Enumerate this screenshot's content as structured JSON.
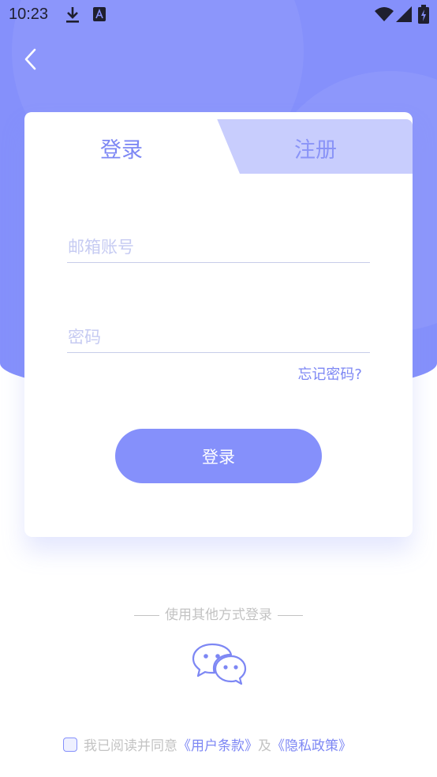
{
  "status_bar": {
    "time": "10:23"
  },
  "tabs": {
    "login_label": "登录",
    "register_label": "注册"
  },
  "form": {
    "email_placeholder": "邮箱账号",
    "email_value": "",
    "password_placeholder": "密码",
    "password_value": "",
    "forgot_label": "忘记密码?",
    "submit_label": "登录"
  },
  "alt_login": {
    "label": "使用其他方式登录",
    "method_icon": "wechat-icon"
  },
  "agreement": {
    "prefix": "我已阅读并同意",
    "terms_link": "《用户条款》",
    "and": "及",
    "privacy_link": "《隐私政策》",
    "checked": false
  },
  "colors": {
    "primary": "#8590fb",
    "tab_inactive": "#c8cdfd",
    "muted": "#c3c3c3"
  }
}
